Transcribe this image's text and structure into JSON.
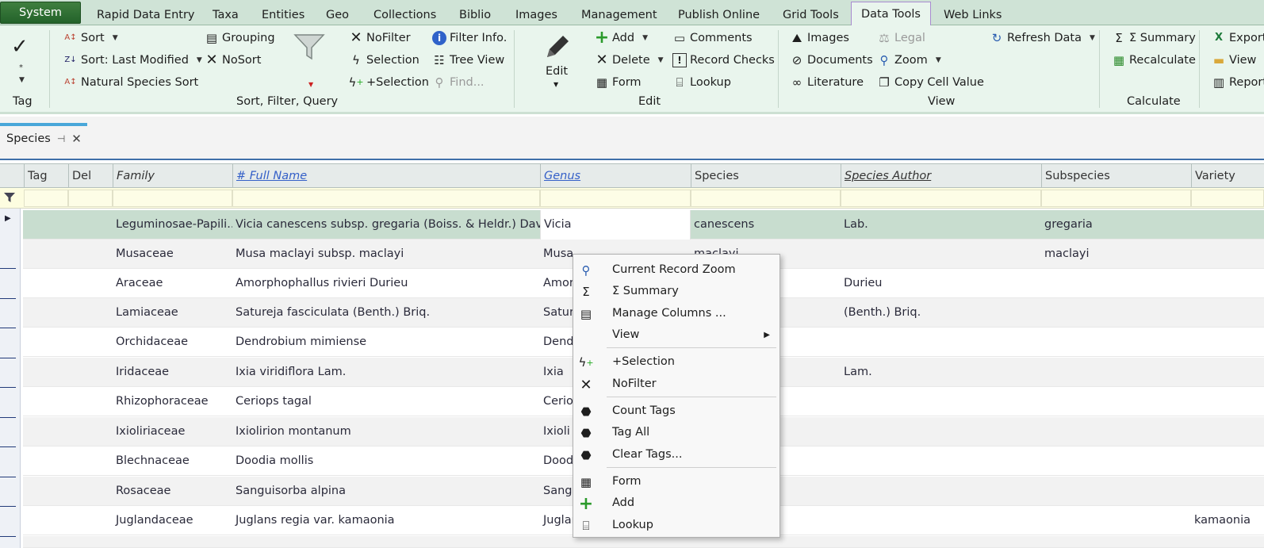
{
  "top_tabs": [
    {
      "label": "System"
    },
    {
      "label": "Rapid Data Entry"
    },
    {
      "label": "Taxa"
    },
    {
      "label": "Entities"
    },
    {
      "label": "Geo"
    },
    {
      "label": "Collections"
    },
    {
      "label": "Biblio"
    },
    {
      "label": "Images"
    },
    {
      "label": "Management"
    },
    {
      "label": "Publish Online"
    },
    {
      "label": "Grid Tools"
    },
    {
      "label": "Data Tools"
    },
    {
      "label": "Web Links"
    }
  ],
  "active_tab": "Data Tools",
  "ribbon": {
    "tag_group": {
      "label": "Tag"
    },
    "sort_group": {
      "label": "Sort, Filter, Query",
      "sort": "Sort",
      "sort_last_modified": "Sort: Last Modified",
      "natural_species_sort": "Natural Species Sort",
      "grouping": "Grouping",
      "nosort": "NoSort",
      "nofilter": "NoFilter",
      "selection": "Selection",
      "plus_selection": "+Selection",
      "filter_info": "Filter Info.",
      "tree_view": "Tree View",
      "find": "Find..."
    },
    "edit_group": {
      "label": "Edit",
      "edit": "Edit",
      "add": "Add",
      "delete": "Delete",
      "form": "Form",
      "comments": "Comments",
      "record_checks": "Record Checks",
      "lookup": "Lookup"
    },
    "view_group": {
      "label": "View",
      "images": "Images",
      "documents": "Documents",
      "literature": "Literature",
      "legal": "Legal",
      "zoom": "Zoom",
      "copy_cell_value": "Copy Cell Value",
      "refresh_data": "Refresh Data"
    },
    "calculate_group": {
      "label": "Calculate",
      "summary": "Σ Summary",
      "recalculate": "Recalculate"
    },
    "export_group": {
      "export": "Export",
      "view": "View",
      "report": "Report"
    }
  },
  "doc_tab": {
    "label": "Species"
  },
  "grid": {
    "columns": [
      "Tag",
      "Del",
      "Family",
      "# Full Name",
      "Genus",
      "Species",
      "Species Author",
      "Subspecies",
      "Variety"
    ],
    "rows": [
      {
        "family": "Leguminosae-Papili...",
        "full_name": "Vicia canescens subsp. gregaria (Boiss. & Heldr.) Davis",
        "genus": "Vicia",
        "species": "canescens",
        "author": "Lab.",
        "subspecies": "gregaria",
        "variety": ""
      },
      {
        "family": "Musaceae",
        "full_name": "Musa maclayi subsp. maclayi",
        "genus": "Musa",
        "species": "maclayi",
        "author": "",
        "subspecies": "maclayi",
        "variety": ""
      },
      {
        "family": "Araceae",
        "full_name": "Amorphophallus rivieri Durieu",
        "genus": "Amor",
        "species": "",
        "author": "Durieu",
        "subspecies": "",
        "variety": ""
      },
      {
        "family": "Lamiaceae",
        "full_name": "Satureja fasciculata (Benth.) Briq.",
        "genus": "Sature",
        "species": "",
        "author": "(Benth.) Briq.",
        "subspecies": "",
        "variety": ""
      },
      {
        "family": "Orchidaceae",
        "full_name": "Dendrobium mimiense",
        "genus": "Dendr",
        "species": "",
        "author": "",
        "subspecies": "",
        "variety": ""
      },
      {
        "family": "Iridaceae",
        "full_name": "Ixia viridiflora Lam.",
        "genus": "Ixia",
        "species": "",
        "author": "Lam.",
        "subspecies": "",
        "variety": ""
      },
      {
        "family": "Rhizophoraceae",
        "full_name": "Ceriops tagal",
        "genus": "Cerio",
        "species": "",
        "author": "",
        "subspecies": "",
        "variety": ""
      },
      {
        "family": "Ixioliriaceae",
        "full_name": "Ixiolirion montanum",
        "genus": "Ixioli",
        "species": "",
        "author": "",
        "subspecies": "",
        "variety": ""
      },
      {
        "family": "Blechnaceae",
        "full_name": "Doodia mollis",
        "genus": "Dood",
        "species": "",
        "author": "",
        "subspecies": "",
        "variety": ""
      },
      {
        "family": "Rosaceae",
        "full_name": "Sanguisorba alpina",
        "genus": "Sangu",
        "species": "",
        "author": "",
        "subspecies": "",
        "variety": ""
      },
      {
        "family": "Juglandaceae",
        "full_name": "Juglans regia var. kamaonia",
        "genus": "Juglar",
        "species": "",
        "author": "",
        "subspecies": "",
        "variety": "kamaonia"
      }
    ]
  },
  "context_menu": {
    "items": [
      {
        "label": "Current Record Zoom",
        "icon": "magnifier-icon"
      },
      {
        "label": "Σ Summary",
        "icon": "sigma-icon"
      },
      {
        "label": "Manage Columns ...",
        "icon": "columns-icon"
      },
      {
        "label": "View",
        "icon": "",
        "submenu": true
      },
      {
        "label": "+Selection",
        "icon": "lightning-plus-icon"
      },
      {
        "label": "NoFilter",
        "icon": "x-icon"
      },
      {
        "label": "Count Tags",
        "icon": "tag-icon"
      },
      {
        "label": "Tag All",
        "icon": "tag-icon"
      },
      {
        "label": "Clear Tags...",
        "icon": "tag-icon"
      },
      {
        "label": "Form",
        "icon": "form-icon"
      },
      {
        "label": "Add",
        "icon": "plus-icon"
      },
      {
        "label": "Lookup",
        "icon": "lookup-icon"
      }
    ]
  },
  "colors": {
    "accent_green": "#23622a",
    "ribbon_bg": "#e9f5ed",
    "selected_row": "#c8ddcf",
    "link_blue": "#3560c8"
  }
}
